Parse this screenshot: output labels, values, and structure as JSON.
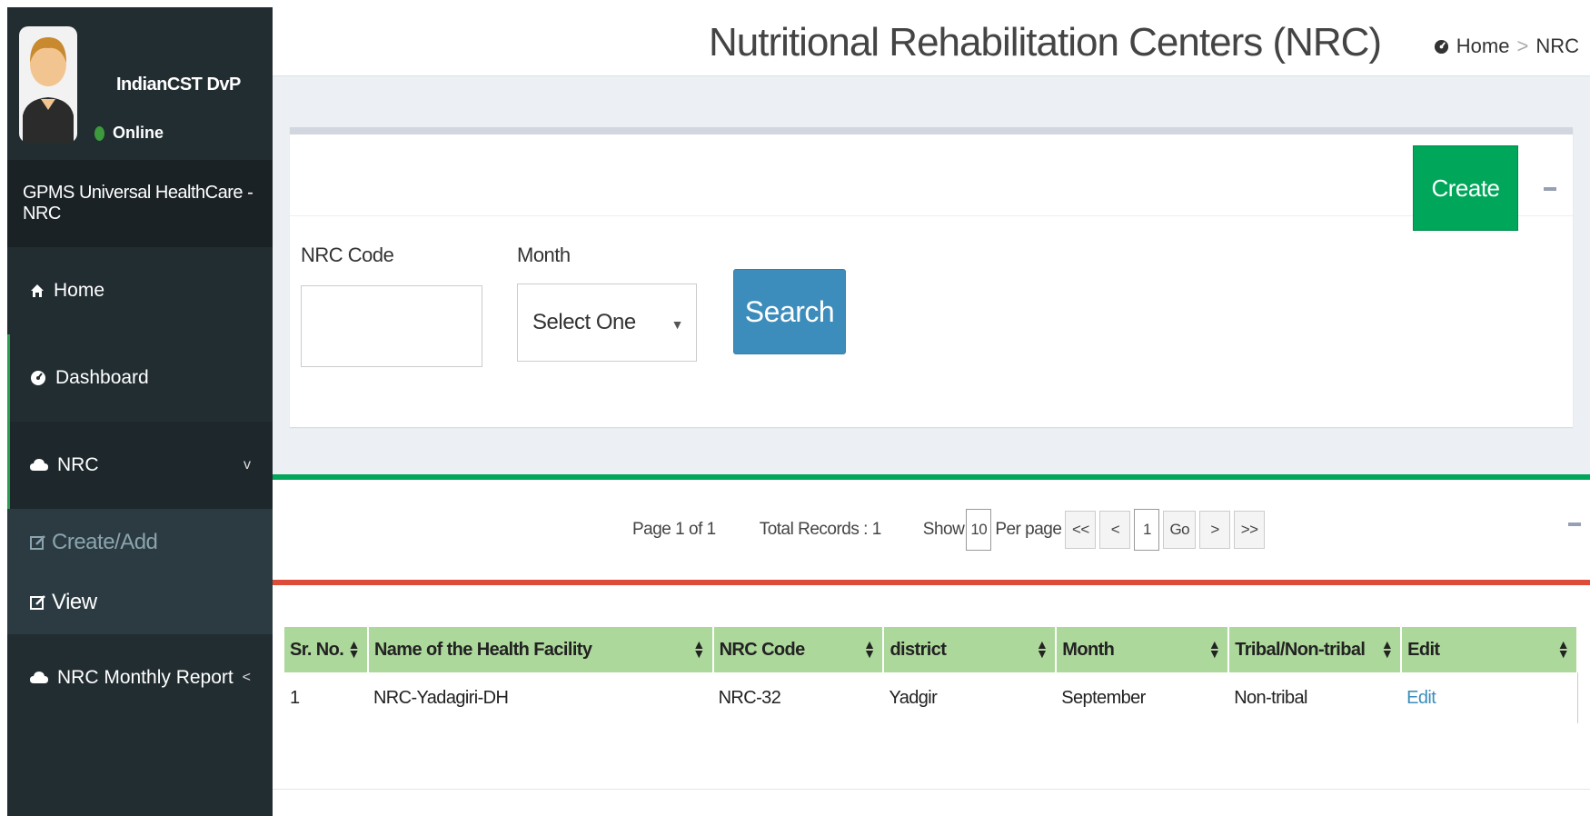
{
  "user": {
    "name": "IndianCST DvP",
    "status": "Online"
  },
  "app_name": "GPMS Universal HealthCare - NRC",
  "nav": {
    "home": "Home",
    "dashboard": "Dashboard",
    "nrc": "NRC",
    "nrc_sub": [
      {
        "label": "Create/Add"
      },
      {
        "label": "View"
      }
    ],
    "monthly_report": "NRC Monthly Report"
  },
  "page": {
    "title": "Nutritional Rehabilitation Centers (NRC)"
  },
  "breadcrumb": {
    "home": "Home",
    "sep": ">",
    "current": "NRC"
  },
  "search": {
    "create_label": "Create",
    "nrc_code_label": "NRC Code",
    "nrc_code_value": "",
    "month_label": "Month",
    "month_value": "Select One",
    "search_label": "Search"
  },
  "pager": {
    "page_info": "Page 1 of 1",
    "total_records": "Total Records : 1",
    "show_label": "Show",
    "per_page_value": "10",
    "per_page_label": "Per page",
    "first": "<<",
    "prev": "<",
    "page_value": "1",
    "go": "Go",
    "next": ">",
    "last": ">>"
  },
  "table": {
    "headers": [
      "Sr. No.",
      "Name of the Health Facility",
      "NRC Code",
      "district",
      "Month",
      "Tribal/Non-tribal",
      "Edit"
    ],
    "rows": [
      [
        "1",
        "NRC-Yadagiri-DH",
        "NRC-32",
        "Yadgir",
        "September",
        "Non-tribal",
        "Edit"
      ]
    ]
  },
  "colors": {
    "sidebar": "#222d32",
    "create_button": "#00a65a",
    "search_button": "#3c8dbc",
    "header_row": "#add89b",
    "danger_border": "#dd4b39"
  }
}
